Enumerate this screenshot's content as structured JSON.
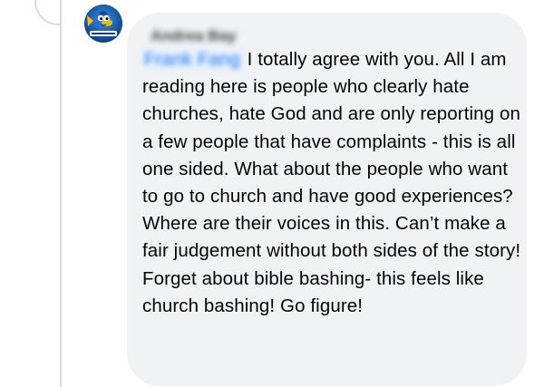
{
  "comment": {
    "author_name": "Andrea Bay",
    "mention": "Frank Fang",
    "text": " I totally agree with you. All I am reading here is people who clearly hate churches, hate God and are only reporting on a few people that have complaints - this is all one sided. What about the people who want to go to church and have good experiences? Where are their voices in this. Can’t make a fair judgement without both sides of the story! Forget about bible bashing- this feels like church bashing! Go figure!"
  },
  "colors": {
    "bubble_background": "#f0f2f5",
    "text": "#050505",
    "mention": "#1877f2",
    "thread_line": "#d9dbe0"
  },
  "icons": {
    "avatar": "cartoon-fish-avatar-icon"
  }
}
